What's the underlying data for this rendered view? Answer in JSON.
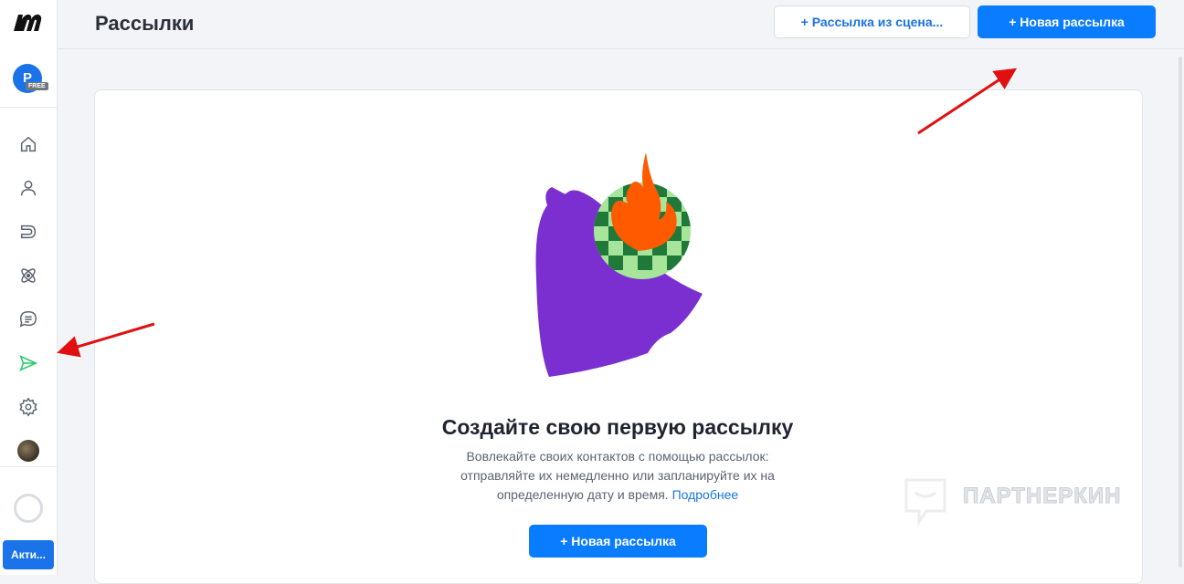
{
  "app": {
    "logo_icon": "manychat-logo-icon",
    "avatar_initial": "P",
    "plan_badge": "FREE",
    "activate_label": "Акти..."
  },
  "header": {
    "title": "Рассылки",
    "scenario_button": "+ Рассылка из сцена...",
    "new_button": "+ Новая рассылка"
  },
  "sidebar": {
    "items": [
      {
        "name": "home",
        "icon": "home-icon"
      },
      {
        "name": "contacts",
        "icon": "user-icon"
      },
      {
        "name": "automation",
        "icon": "magnet-icon"
      },
      {
        "name": "integrations",
        "icon": "atom-icon"
      },
      {
        "name": "live-chat",
        "icon": "chat-icon"
      },
      {
        "name": "broadcasts",
        "icon": "send-icon",
        "active": true
      },
      {
        "name": "settings",
        "icon": "gear-icon"
      }
    ]
  },
  "empty_state": {
    "title": "Создайте свою первую рассылку",
    "desc_line1": "Вовлекайте своих контактов с помощью рассылок:",
    "desc_line2": "отправляйте их немедленно или запланируйте их на",
    "desc_line3": "определенную дату и время.",
    "learn_more": "Подробнее",
    "button": "+ Новая рассылка"
  },
  "watermark": {
    "text": "ПАРТНЕРКИН"
  },
  "colors": {
    "accent": "#0a7cff",
    "active_nav": "#2ecc71",
    "bell": "#7b2fd0",
    "flame": "#ff5a00",
    "arrow": "#e01010"
  }
}
